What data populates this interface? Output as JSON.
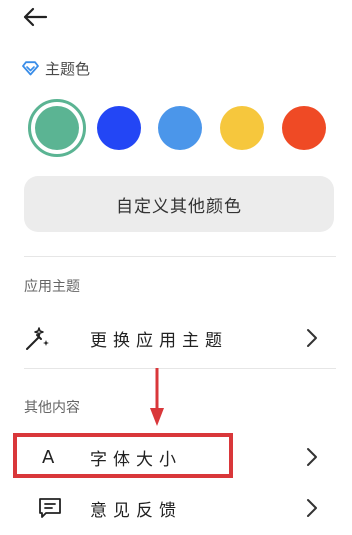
{
  "header": {
    "back_icon": "arrow-left-icon"
  },
  "theme": {
    "title": "主题色",
    "title_icon": "diamond-icon",
    "accent": "#5bb493",
    "swatches": [
      {
        "color": "#5bb493",
        "selected": true
      },
      {
        "color": "#2346f5",
        "selected": false
      },
      {
        "color": "#4b96ea",
        "selected": false
      },
      {
        "color": "#f6c73d",
        "selected": false
      },
      {
        "color": "#ef4a25",
        "selected": false
      }
    ],
    "custom_label": "自定义其他颜色"
  },
  "app_theme": {
    "title": "应用主题",
    "item": {
      "label": "更换应用主题",
      "icon": "magic-wand-icon"
    }
  },
  "other": {
    "title": "其他内容",
    "items": [
      {
        "label": "字体大小",
        "icon": "letter-a-icon",
        "icon_text": "A"
      },
      {
        "label": "意见反馈",
        "icon": "message-icon"
      }
    ]
  },
  "annotation": {
    "highlight_color": "#d9373a"
  }
}
